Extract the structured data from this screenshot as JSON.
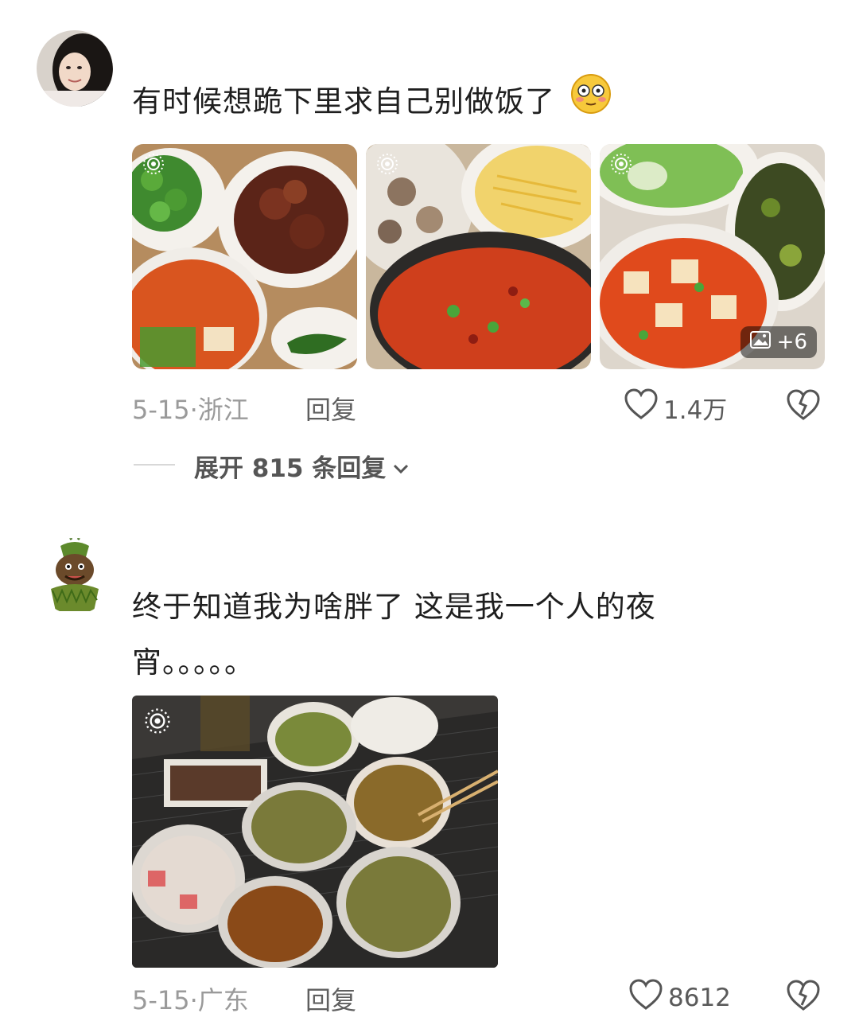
{
  "comments": [
    {
      "text": "有时候想跪下里求自己别做饭了",
      "emoji": "😳",
      "date": "5-15",
      "location": "浙江",
      "reply_label": "回复",
      "likes": "1.4万",
      "more_images": "+6",
      "expand_label": "展开 815 条回复"
    },
    {
      "text_line1": "终于知道我为啥胖了 这是我一个人的夜",
      "text_line2": "宵。。。。。",
      "date": "5-15",
      "location": "广东",
      "reply_label": "回复",
      "likes": "8612"
    }
  ],
  "colors": {
    "meta": "#9a9a9a",
    "text": "#1f1f1f",
    "icon": "#5a5a5a"
  },
  "icons": [
    "heart-icon",
    "dislike-icon",
    "chevron-down-icon",
    "live-photo-icon",
    "image-gallery-icon"
  ]
}
